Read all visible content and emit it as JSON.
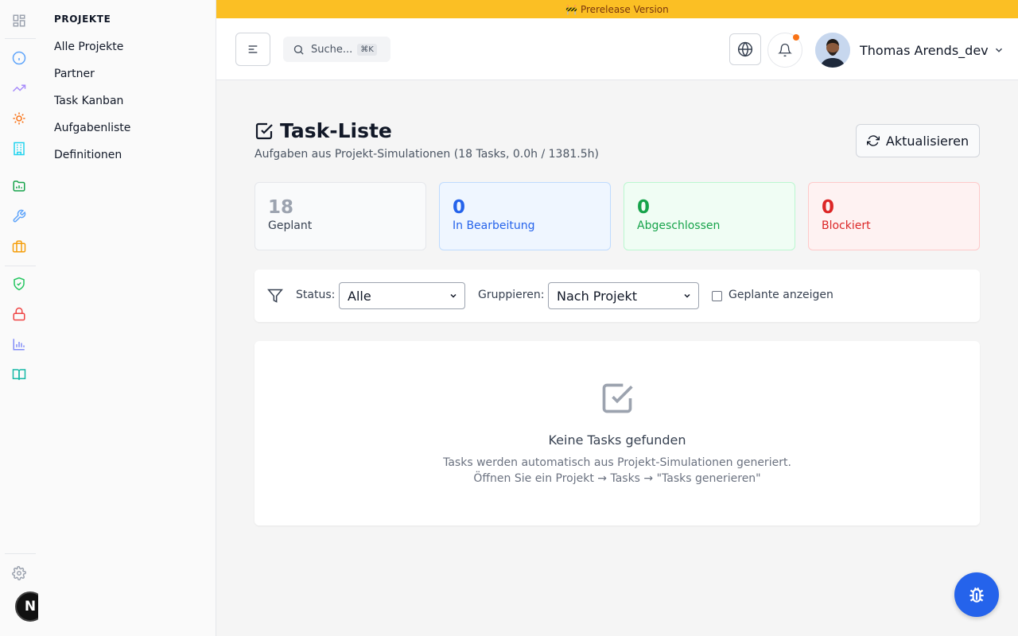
{
  "banner": {
    "text": "🚧 Prerelease Version",
    "color": "#fbbf24"
  },
  "rail": {
    "icons": [
      "dashboard-icon",
      "info-icon",
      "trending-icon",
      "settings-sun-icon",
      "building-icon",
      "folder-chart-icon",
      "wrench-icon",
      "briefcase-icon",
      "shield-check-icon",
      "lock-icon",
      "bar-chart-icon",
      "book-icon",
      "gear-icon"
    ]
  },
  "subnav": {
    "heading": "PROJEKTE",
    "items": [
      {
        "label": "Alle Projekte"
      },
      {
        "label": "Partner"
      },
      {
        "label": "Task Kanban"
      },
      {
        "label": "Aufgabenliste"
      },
      {
        "label": "Definitionen"
      }
    ]
  },
  "header": {
    "search_placeholder": "Suche...",
    "search_shortcut": "⌘K",
    "user_name": "Thomas Arends_dev",
    "notification_dot_color": "#f97316"
  },
  "page": {
    "title": "Task-Liste",
    "subtitle": "Aufgaben aus Projekt-Simulationen (18 Tasks, 0.0h / 1381.5h)",
    "refresh_label": "Aktualisieren"
  },
  "stats": [
    {
      "value": "18",
      "label": "Geplant",
      "bg": "#f9fafb",
      "border": "#e5e7eb",
      "num_color": "#9ca3af",
      "label_color": "#374151"
    },
    {
      "value": "0",
      "label": "In Bearbeitung",
      "bg": "#eff6ff",
      "border": "#bfdbfe",
      "num_color": "#2563eb",
      "label_color": "#2563eb"
    },
    {
      "value": "0",
      "label": "Abgeschlossen",
      "bg": "#f0fdf4",
      "border": "#bbf7d0",
      "num_color": "#16a34a",
      "label_color": "#16a34a"
    },
    {
      "value": "0",
      "label": "Blockiert",
      "bg": "#fef2f2",
      "border": "#fecaca",
      "num_color": "#dc2626",
      "label_color": "#dc2626"
    }
  ],
  "filters": {
    "status_label": "Status:",
    "status_value": "Alle",
    "group_label": "Gruppieren:",
    "group_value": "Nach Projekt",
    "show_planned_label": "Geplante anzeigen",
    "show_planned_checked": false
  },
  "empty": {
    "title": "Keine Tasks gefunden",
    "line1": "Tasks werden automatisch aus Projekt-Simulationen generiert.",
    "line2": "Öffnen Sie ein Projekt → Tasks → \"Tasks generieren\""
  },
  "next_badge": "N"
}
